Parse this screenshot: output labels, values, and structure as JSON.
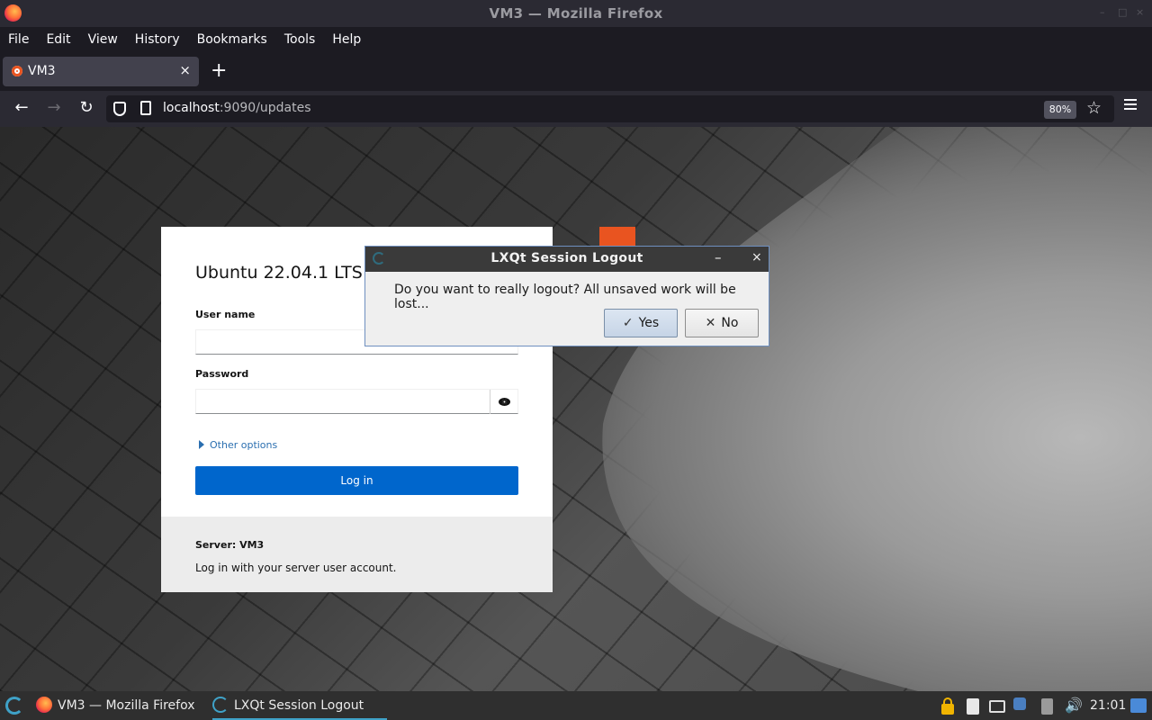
{
  "window": {
    "title": "VM3 — Mozilla Firefox",
    "controls": [
      "–",
      "□",
      "×"
    ]
  },
  "menubar": {
    "items": [
      {
        "label": "File"
      },
      {
        "label": "Edit"
      },
      {
        "label": "View"
      },
      {
        "label": "History"
      },
      {
        "label": "Bookmarks"
      },
      {
        "label": "Tools"
      },
      {
        "label": "Help"
      }
    ]
  },
  "tabs": [
    {
      "label": "VM3",
      "close": "×",
      "active": true
    }
  ],
  "newtab_label": "+",
  "navbar": {
    "back": "←",
    "forward": "→",
    "reload": "↻",
    "url_host": "localhost",
    "url_rest": ":9090/updates",
    "zoom": "80%",
    "star": "☆"
  },
  "login": {
    "os_title": "Ubuntu 22.04.1 LTS",
    "username_label": "User name",
    "username_value": "",
    "password_label": "Password",
    "password_value": "",
    "other_options": "Other options",
    "login_button": "Log in",
    "server_label": "Server: VM3",
    "hint": "Log in with your server user account."
  },
  "dialog": {
    "title": "LXQt Session Logout",
    "minimize": "–",
    "close": "×",
    "message": "Do you want to really logout? All unsaved work will be lost...",
    "yes_icon": "✓",
    "yes_label": "Yes",
    "no_icon": "✕",
    "no_label": "No"
  },
  "taskbar": {
    "tasks": [
      {
        "label": "VM3 — Mozilla Firefox",
        "active": false
      },
      {
        "label": "LXQt Session Logout",
        "active": true
      }
    ],
    "volume_icon": "🔊",
    "clock": "21:01"
  },
  "colors": {
    "accent_blue": "#0066cc",
    "ubuntu_orange": "#e95420",
    "taskbar_active": "#3fa2c8"
  }
}
